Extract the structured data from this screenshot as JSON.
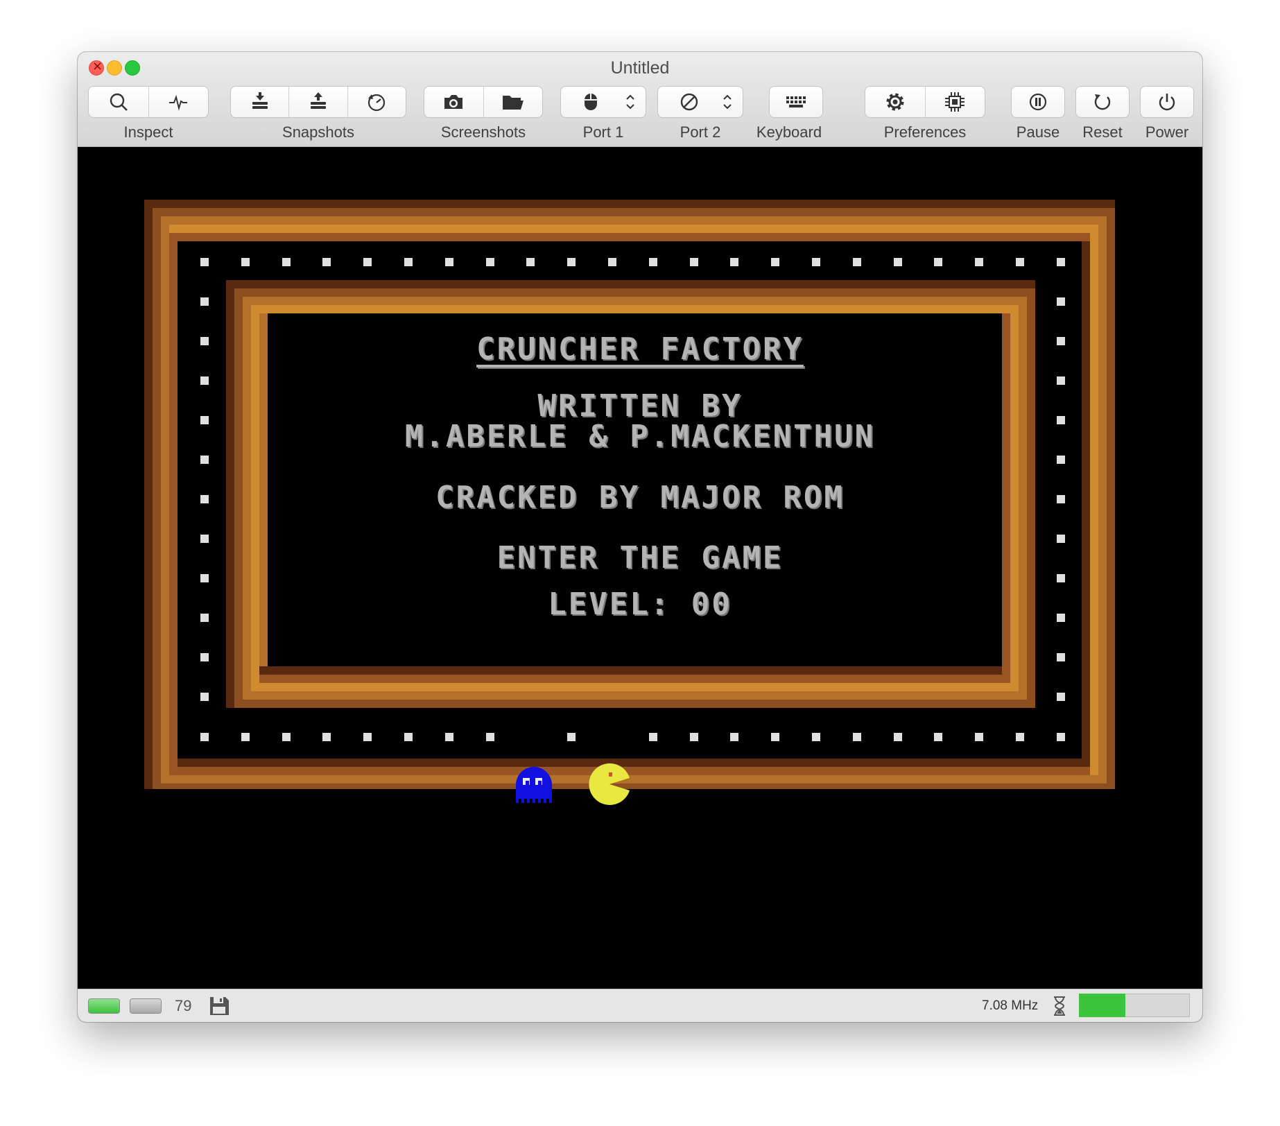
{
  "window": {
    "title": "Untitled"
  },
  "toolbar": {
    "inspect": {
      "label": "Inspect"
    },
    "snapshots": {
      "label": "Snapshots"
    },
    "screenshots": {
      "label": "Screenshots"
    },
    "port1": {
      "label": "Port 1"
    },
    "port2": {
      "label": "Port 2"
    },
    "keyboard": {
      "label": "Keyboard"
    },
    "preferences": {
      "label": "Preferences"
    },
    "pause": {
      "label": "Pause"
    },
    "reset": {
      "label": "Reset"
    },
    "power": {
      "label": "Power"
    }
  },
  "screen": {
    "title": "CRUNCHER FACTORY",
    "line1": "WRITTEN BY",
    "line2": "M.ABERLE & P.MACKENTHUN",
    "line3": "CRACKED BY MAJOR ROM",
    "line4": "ENTER THE GAME",
    "line5": "LEVEL: 00"
  },
  "statusbar": {
    "track": "79",
    "clock": "7.08 MHz",
    "speed_fraction": 0.42
  },
  "colors": {
    "frame_dark": "#5a2a10",
    "frame_mid": "#8d4f20",
    "frame_light": "#b5712a",
    "frame_bright": "#d08a30",
    "dot": "#e0e0e0",
    "text": "#b4b4b4",
    "ghost": "#1010e0",
    "pacman": "#e8e840",
    "led_green": "#3cc43c"
  }
}
